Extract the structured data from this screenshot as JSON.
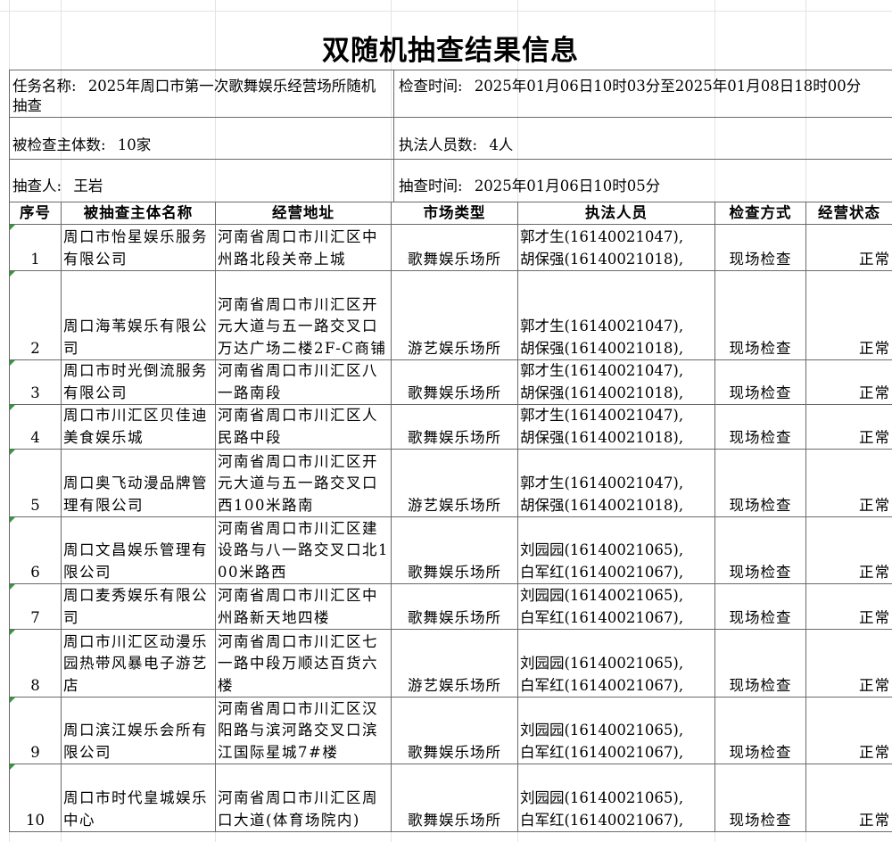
{
  "title": "双随机抽查结果信息",
  "info": {
    "task_label": "任务名称:",
    "task_value": "2025年周口市第一次歌舞娱乐经营场所随机抽查",
    "inspect_time_label": "检查时间:",
    "inspect_time_value": "2025年01月06日10时03分至2025年01月08日18时00分",
    "subjects_label": "被检查主体数:",
    "subjects_value": "10家",
    "officers_label": "执法人员数:",
    "officers_value": "4人",
    "sampler_label": "抽查人:",
    "sampler_value": "王岩",
    "sample_time_label": "抽查时间:",
    "sample_time_value": "2025年01月06日10时05分"
  },
  "table": {
    "headers": [
      "序号",
      "被抽查主体名称",
      "经营地址",
      "市场类型",
      "执法人员",
      "检查方式",
      "经营状态"
    ],
    "rows": [
      {
        "seq": "1",
        "name": "周口市怡星娱乐服务有限公司",
        "address": "河南省周口市川汇区中州路北段关帝上城",
        "market": "歌舞娱乐场所",
        "staff1": "郭才生(16140021047),",
        "staff2": "胡保强(16140021018),",
        "method": "现场检查",
        "status": "正常"
      },
      {
        "seq": "2",
        "name": "周口海苇娱乐有限公司",
        "address": "河南省周口市川汇区开元大道与五一路交叉口万达广场二楼2F-C商铺",
        "market": "游艺娱乐场所",
        "staff1": "郭才生(16140021047),",
        "staff2": "胡保强(16140021018),",
        "method": "现场检查",
        "status": "正常"
      },
      {
        "seq": "3",
        "name": "周口市时光倒流服务有限公司",
        "address": "河南省周口市川汇区八一路南段",
        "market": "歌舞娱乐场所",
        "staff1": "郭才生(16140021047),",
        "staff2": "胡保强(16140021018),",
        "method": "现场检查",
        "status": "正常"
      },
      {
        "seq": "4",
        "name": "周口市川汇区贝佳迪美食娱乐城",
        "address": "河南省周口市川汇区人民路中段",
        "market": "歌舞娱乐场所",
        "staff1": "郭才生(16140021047),",
        "staff2": "胡保强(16140021018),",
        "method": "现场检查",
        "status": "正常"
      },
      {
        "seq": "5",
        "name": "周口奥飞动漫品牌管理有限公司",
        "address": "河南省周口市川汇区开元大道与五一路交叉口西100米路南",
        "market": "游艺娱乐场所",
        "staff1": "郭才生(16140021047),",
        "staff2": "胡保强(16140021018),",
        "method": "现场检查",
        "status": "正常"
      },
      {
        "seq": "6",
        "name": "周口文昌娱乐管理有限公司",
        "address": "河南省周口市川汇区建设路与八一路交叉口北100米路西",
        "market": "歌舞娱乐场所",
        "staff1": "刘园园(16140021065),",
        "staff2": "白军红(16140021067),",
        "method": "现场检查",
        "status": "正常"
      },
      {
        "seq": "7",
        "name": "周口麦秀娱乐有限公司",
        "address": "河南省周口市川汇区中州路新天地四楼",
        "market": "歌舞娱乐场所",
        "staff1": "刘园园(16140021065),",
        "staff2": "白军红(16140021067),",
        "method": "现场检查",
        "status": "正常"
      },
      {
        "seq": "8",
        "name": "周口市川汇区动漫乐园热带风暴电子游艺店",
        "address": "河南省周口市川汇区七一路中段万顺达百货六楼",
        "market": "游艺娱乐场所",
        "staff1": "刘园园(16140021065),",
        "staff2": "白军红(16140021067),",
        "method": "现场检查",
        "status": "正常"
      },
      {
        "seq": "9",
        "name": "周口滨江娱乐会所有限公司",
        "address": "河南省周口市川汇区汉阳路与滨河路交叉口滨江国际星城7#楼",
        "market": "歌舞娱乐场所",
        "staff1": "刘园园(16140021065),",
        "staff2": "白军红(16140021067),",
        "method": "现场检查",
        "status": "正常"
      },
      {
        "seq": "10",
        "name": "周口市时代皇城娱乐中心",
        "address": "河南省周口市川汇区周口大道(体育场院内)",
        "market": "歌舞娱乐场所",
        "staff1": "刘园园(16140021065),",
        "staff2": "白军红(16140021067),",
        "method": "现场检查",
        "status": "正常"
      }
    ]
  }
}
